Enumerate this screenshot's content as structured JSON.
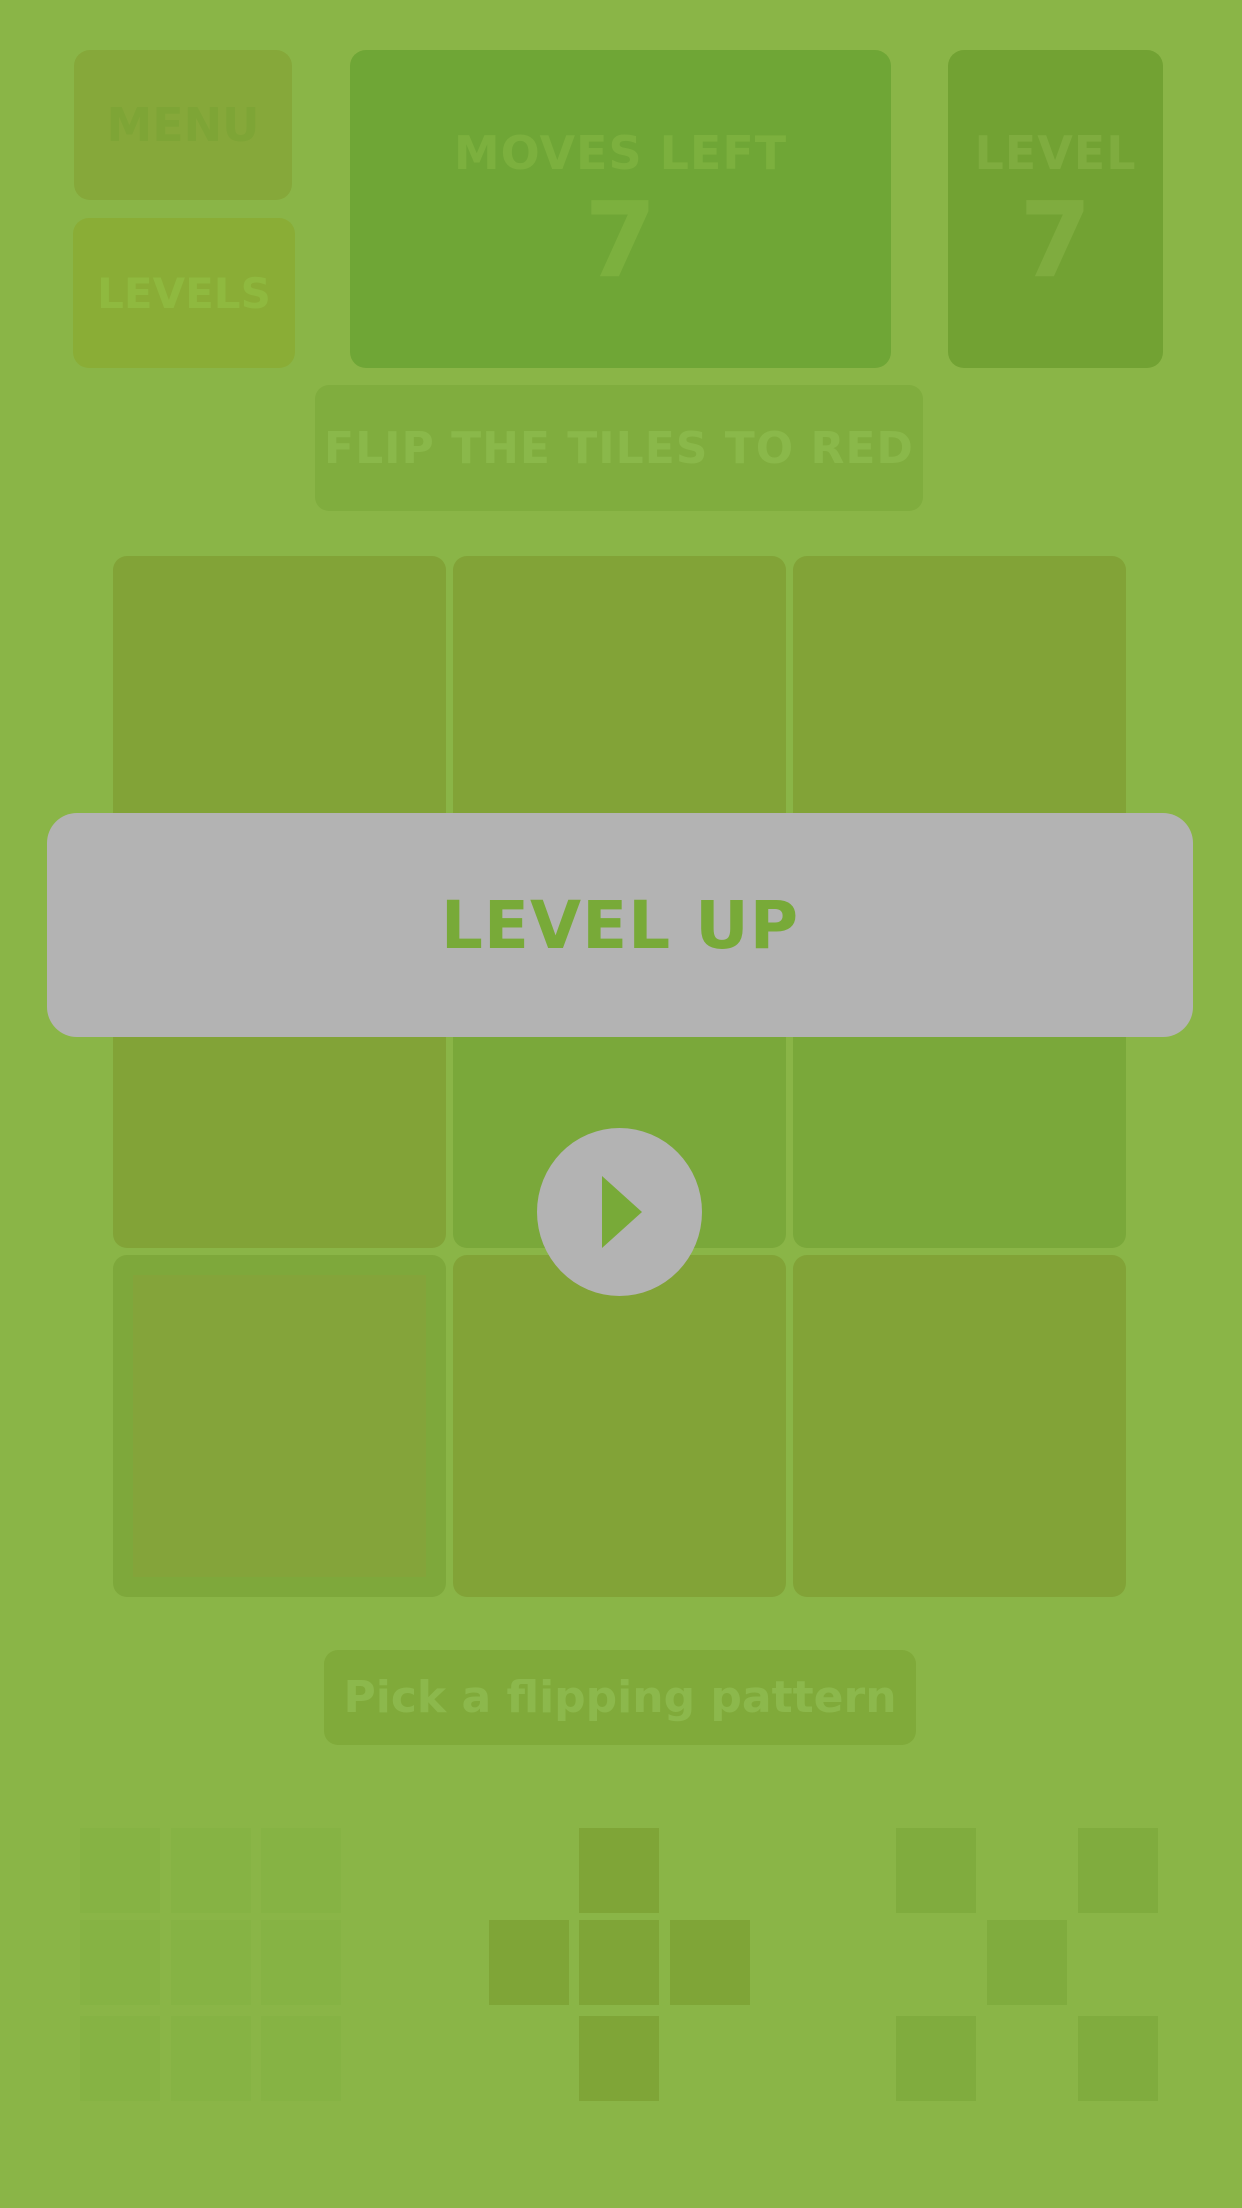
{
  "header": {
    "menu_label": "MENU",
    "levels_label": "LEVELS",
    "moves_left_label": "MOVES LEFT",
    "moves_left_value": "7",
    "level_label": "LEVEL",
    "level_value": "7"
  },
  "goal_text": "FLIP THE TILES TO RED",
  "board": {
    "rows": 3,
    "cols": 3,
    "selected_tile": "row 3, column 1"
  },
  "overlay": {
    "banner_text": "LEVEL UP",
    "play_icon": "play-icon"
  },
  "pattern_hint": "Pick a flipping pattern",
  "patterns": [
    {
      "name": "full-square",
      "cells": [
        [
          1,
          1,
          1
        ],
        [
          1,
          1,
          1
        ],
        [
          1,
          1,
          1
        ]
      ]
    },
    {
      "name": "plus",
      "cells": [
        [
          0,
          1,
          0
        ],
        [
          1,
          1,
          1
        ],
        [
          0,
          1,
          0
        ]
      ]
    },
    {
      "name": "x-corners",
      "cells": [
        [
          1,
          0,
          1
        ],
        [
          0,
          1,
          0
        ],
        [
          1,
          0,
          1
        ]
      ]
    }
  ],
  "colors": {
    "background": "#8ab547",
    "overlay_gray": "#b3b3b3",
    "accent_green": "#78aa38"
  }
}
